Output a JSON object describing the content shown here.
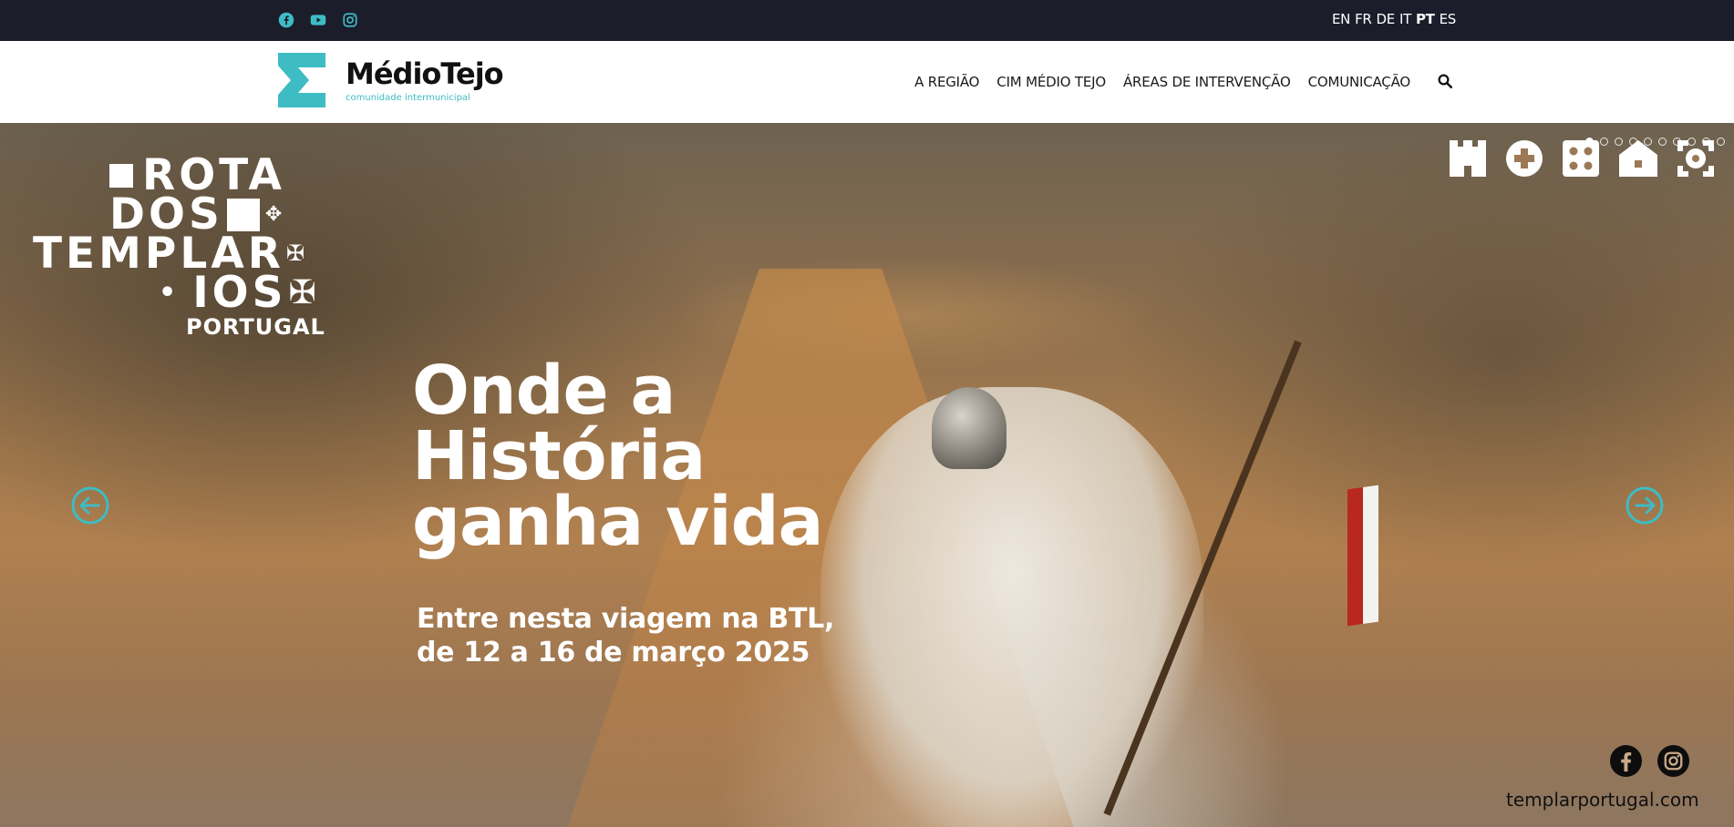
{
  "topbar": {
    "social": [
      "facebook-icon",
      "youtube-icon",
      "instagram-icon"
    ],
    "languages": [
      "EN",
      "FR",
      "DE",
      "IT",
      "PT",
      "ES"
    ],
    "active_language": "PT"
  },
  "header": {
    "logo_name": "MédioTejo",
    "logo_subtitle": "comunidade intermunicipal",
    "nav": [
      "A REGIÃO",
      "CIM MÉDIO TEJO",
      "ÁREAS DE INTERVENÇÃO",
      "COMUNICAÇÃO"
    ],
    "search_icon": "search-icon"
  },
  "hero": {
    "brand_lines": [
      "ROTA",
      "DOS",
      "TEMPLAR",
      "IOS"
    ],
    "brand_country": "PORTUGAL",
    "headline": [
      "Onde a",
      "História",
      "ganha vida"
    ],
    "subline": [
      "Entre nesta viagem na BTL,",
      "de 12 a 16 de março 2025"
    ],
    "website": "templarportugal.com",
    "social": [
      "facebook-icon",
      "instagram-icon"
    ],
    "slides_count": 10,
    "active_slide": 1,
    "symbols": [
      "castle-icon",
      "cross-circle-icon",
      "dots-square-icon",
      "house-icon",
      "target-square-icon"
    ]
  },
  "colors": {
    "topbar_bg": "#1c1d2b",
    "accent_teal": "#3ebcc4",
    "text_dark": "#111111"
  }
}
